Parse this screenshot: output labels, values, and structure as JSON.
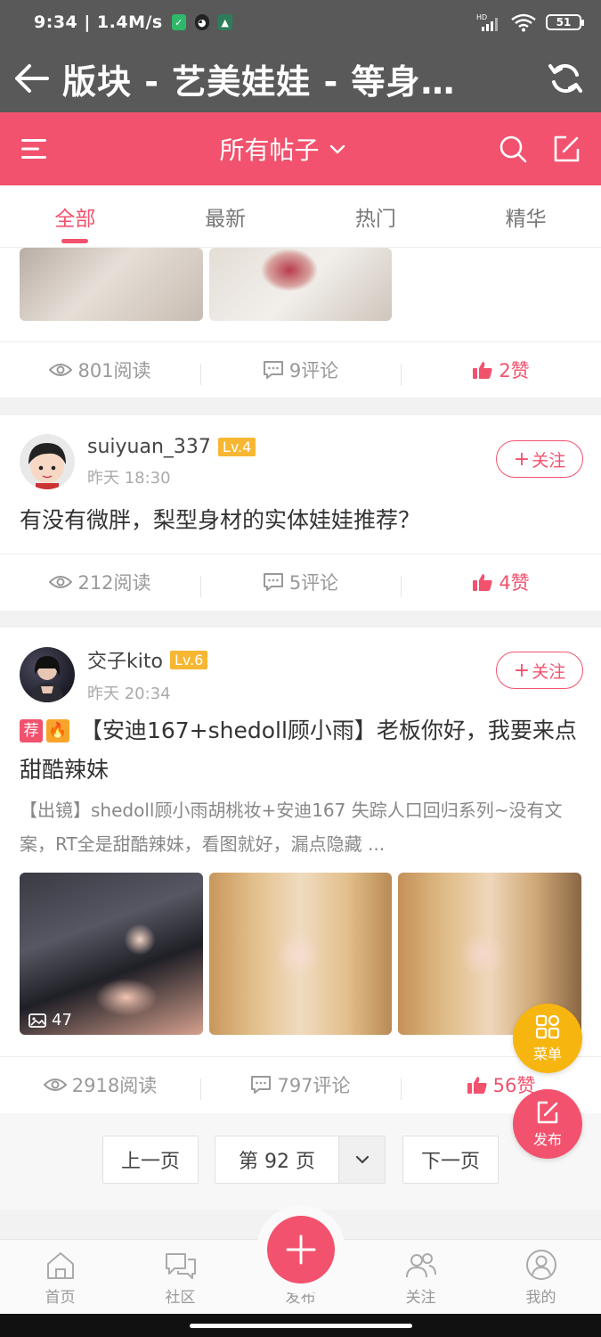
{
  "status": {
    "time": "9:34 | 1.4M/s",
    "battery": "51",
    "hd": "HD"
  },
  "titlebar": {
    "title": "版块 - 艺美娃娃 - 等身…"
  },
  "header": {
    "filter_label": "所有帖子"
  },
  "tabs": [
    {
      "label": "全部"
    },
    {
      "label": "最新"
    },
    {
      "label": "热门"
    },
    {
      "label": "精华"
    }
  ],
  "posts": [
    {
      "views": "801阅读",
      "comments": "9评论",
      "likes": "2赞"
    },
    {
      "username": "suiyuan_337",
      "level": "Lv.4",
      "time": "昨天 18:30",
      "follow": "关注",
      "title": "有没有微胖，梨型身材的实体娃娃推荐？",
      "views": "212阅读",
      "comments": "5评论",
      "likes": "4赞"
    },
    {
      "username": "交子kito",
      "level": "Lv.6",
      "time": "昨天 20:34",
      "follow": "关注",
      "tag_rec": "荐",
      "title": "【安迪167+shedoll顾小雨】老板你好，我要来点甜酷辣妹",
      "excerpt": "【出镜】shedoll顾小雨胡桃妆+安迪167 失踪人口回归系列~没有文案，RT全是甜酷辣妹，看图就好，漏点隐藏 ...",
      "image_count": "47",
      "views": "2918阅读",
      "comments": "797评论",
      "likes": "56赞"
    }
  ],
  "pager": {
    "prev": "上一页",
    "current": "第 92 页",
    "next": "下一页"
  },
  "fab": {
    "menu": "菜单",
    "publish": "发布"
  },
  "bottom_nav": [
    {
      "label": "首页"
    },
    {
      "label": "社区"
    },
    {
      "label": "发布"
    },
    {
      "label": "关注"
    },
    {
      "label": "我的"
    }
  ],
  "colors": {
    "accent": "#f2526e",
    "topbar": "#595959",
    "level": "#f7b733"
  }
}
